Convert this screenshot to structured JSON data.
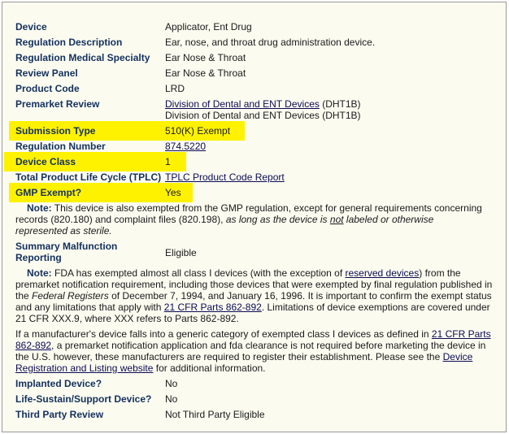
{
  "rows": {
    "device": {
      "label": "Device",
      "value": "Applicator, Ent Drug"
    },
    "regulation_description": {
      "label": "Regulation Description",
      "value": "Ear, nose, and throat drug administration device."
    },
    "medical_specialty": {
      "label": "Regulation Medical Specialty",
      "value": "Ear Nose & Throat"
    },
    "review_panel": {
      "label": "Review Panel",
      "value": "Ear Nose & Throat"
    },
    "product_code": {
      "label": "Product Code",
      "value": "LRD"
    },
    "premarket_review": {
      "label": "Premarket Review",
      "line1_link": "Division of Dental and ENT Devices",
      "line1_suffix": " (DHT1B)",
      "line2": "Division of Dental and ENT Devices (DHT1B)"
    },
    "submission_type": {
      "label": "Submission Type",
      "value": "510(K) Exempt"
    },
    "regulation_number": {
      "label": "Regulation Number",
      "value": "874.5220"
    },
    "device_class": {
      "label": "Device Class",
      "value": "1"
    },
    "tplc": {
      "label": "Total Product Life Cycle (TPLC)",
      "value": "TPLC Product Code Report"
    },
    "gmp_exempt": {
      "label": "GMP Exempt?",
      "value": "Yes"
    },
    "summary_malfunction": {
      "label_line1": "Summary Malfunction",
      "label_line2": "Reporting",
      "value": "Eligible"
    },
    "implanted": {
      "label": "Implanted Device?",
      "value": "No"
    },
    "life_sustain": {
      "label": "Life-Sustain/Support Device?",
      "value": "No"
    },
    "third_party": {
      "label": "Third Party Review",
      "value": "Not Third Party Eligible"
    }
  },
  "gmp_note": {
    "prefix": "Note:",
    "t1": " This device is also exempted from the GMP regulation, except for general requirements concerning records (820.180) and complaint files (820.198), ",
    "t2": "as long as the device is ",
    "t3": "not",
    "t4": " labeled or otherwise represented as sterile."
  },
  "fda_note": {
    "prefix": "Note:",
    "t1": " FDA has exempted almost all class I devices (with the exception of ",
    "link1": "reserved devices",
    "t2": ") from the premarket notification requirement, including those devices that were exempted by final regulation published in the ",
    "t3": "Federal Registers",
    "t4": " of December 7, 1994, and January 16, 1996. It is important to confirm the exempt status and any limitations that apply with ",
    "link2": "21 CFR Parts 862-892",
    "t5": ". Limitations of device exemptions are covered under 21 CFR XXX.9, where XXX refers to Parts 862-892."
  },
  "generic_note": {
    "t1": "If a manufacturer's device falls into a generic category of exempted class I devices as defined in ",
    "link1": "21 CFR Parts 862-892",
    "t2": ", a premarket notification application and fda clearance is not required before marketing the device in the U.S. however, these manufacturers are required to register their establishment. Please see the ",
    "link2": "Device Registration and Listing website",
    "t3": " for additional information."
  },
  "colors": {
    "highlight": "#fff200",
    "label": "#13305e",
    "panel_bg": "#fbfbf0",
    "link": "#0b0b55"
  }
}
